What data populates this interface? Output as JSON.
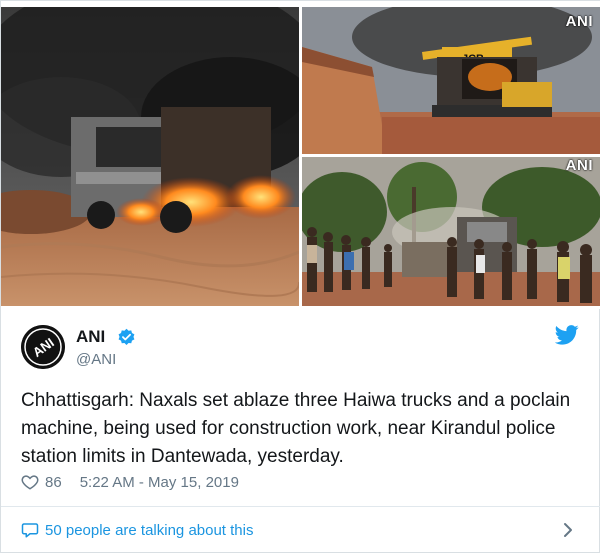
{
  "media": {
    "watermark_top": "ANI",
    "watermark_bottom": "ANI",
    "excavator_brand": "JCB"
  },
  "author": {
    "name": "ANI",
    "handle": "@ANI",
    "avatar_text": "ANI"
  },
  "tweet": {
    "text": "Chhattisgarh: Naxals set ablaze three Haiwa trucks and a poclain machine, being used for construction work, near Kirandul police station limits in Dantewada, yesterday."
  },
  "meta": {
    "likes": "86",
    "timestamp": "5:22 AM - May 15, 2019"
  },
  "footer": {
    "talking_text": "50 people are talking about this"
  },
  "colors": {
    "accent": "#1da1f2",
    "link": "#1b95e0",
    "muted": "#657786",
    "text": "#14171a"
  }
}
